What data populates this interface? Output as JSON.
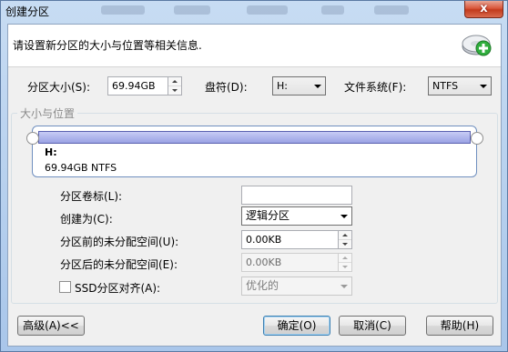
{
  "window": {
    "title": "创建分区",
    "close_symbol": "x"
  },
  "header": {
    "text": "请设置新分区的大小与位置等相关信息.",
    "icon": "disk-add-icon"
  },
  "size": {
    "label": "分区大小(S):",
    "value": "69.94GB"
  },
  "drive_letter": {
    "label": "盘符(D):",
    "value": "H:"
  },
  "filesystem": {
    "label": "文件系统(F):",
    "value": "NTFS"
  },
  "group": {
    "title": "大小与位置"
  },
  "partition_preview": {
    "name": "H:",
    "detail": "69.94GB NTFS",
    "bar_color": "#9aa2e4"
  },
  "volume_label": {
    "label": "分区卷标(L):",
    "value": ""
  },
  "create_as": {
    "label": "创建为(C):",
    "value": "逻辑分区"
  },
  "free_before": {
    "label": "分区前的未分配空间(U):",
    "value": "0.00KB"
  },
  "free_after": {
    "label": "分区后的未分配空间(E):",
    "value": "0.00KB"
  },
  "ssd_align": {
    "label": "SSD分区对齐(A):",
    "checked": false,
    "value": "优化的"
  },
  "buttons": {
    "advanced": "高级(A)<<",
    "ok": "确定(O)",
    "cancel": "取消(C)",
    "help": "帮助(H)"
  }
}
